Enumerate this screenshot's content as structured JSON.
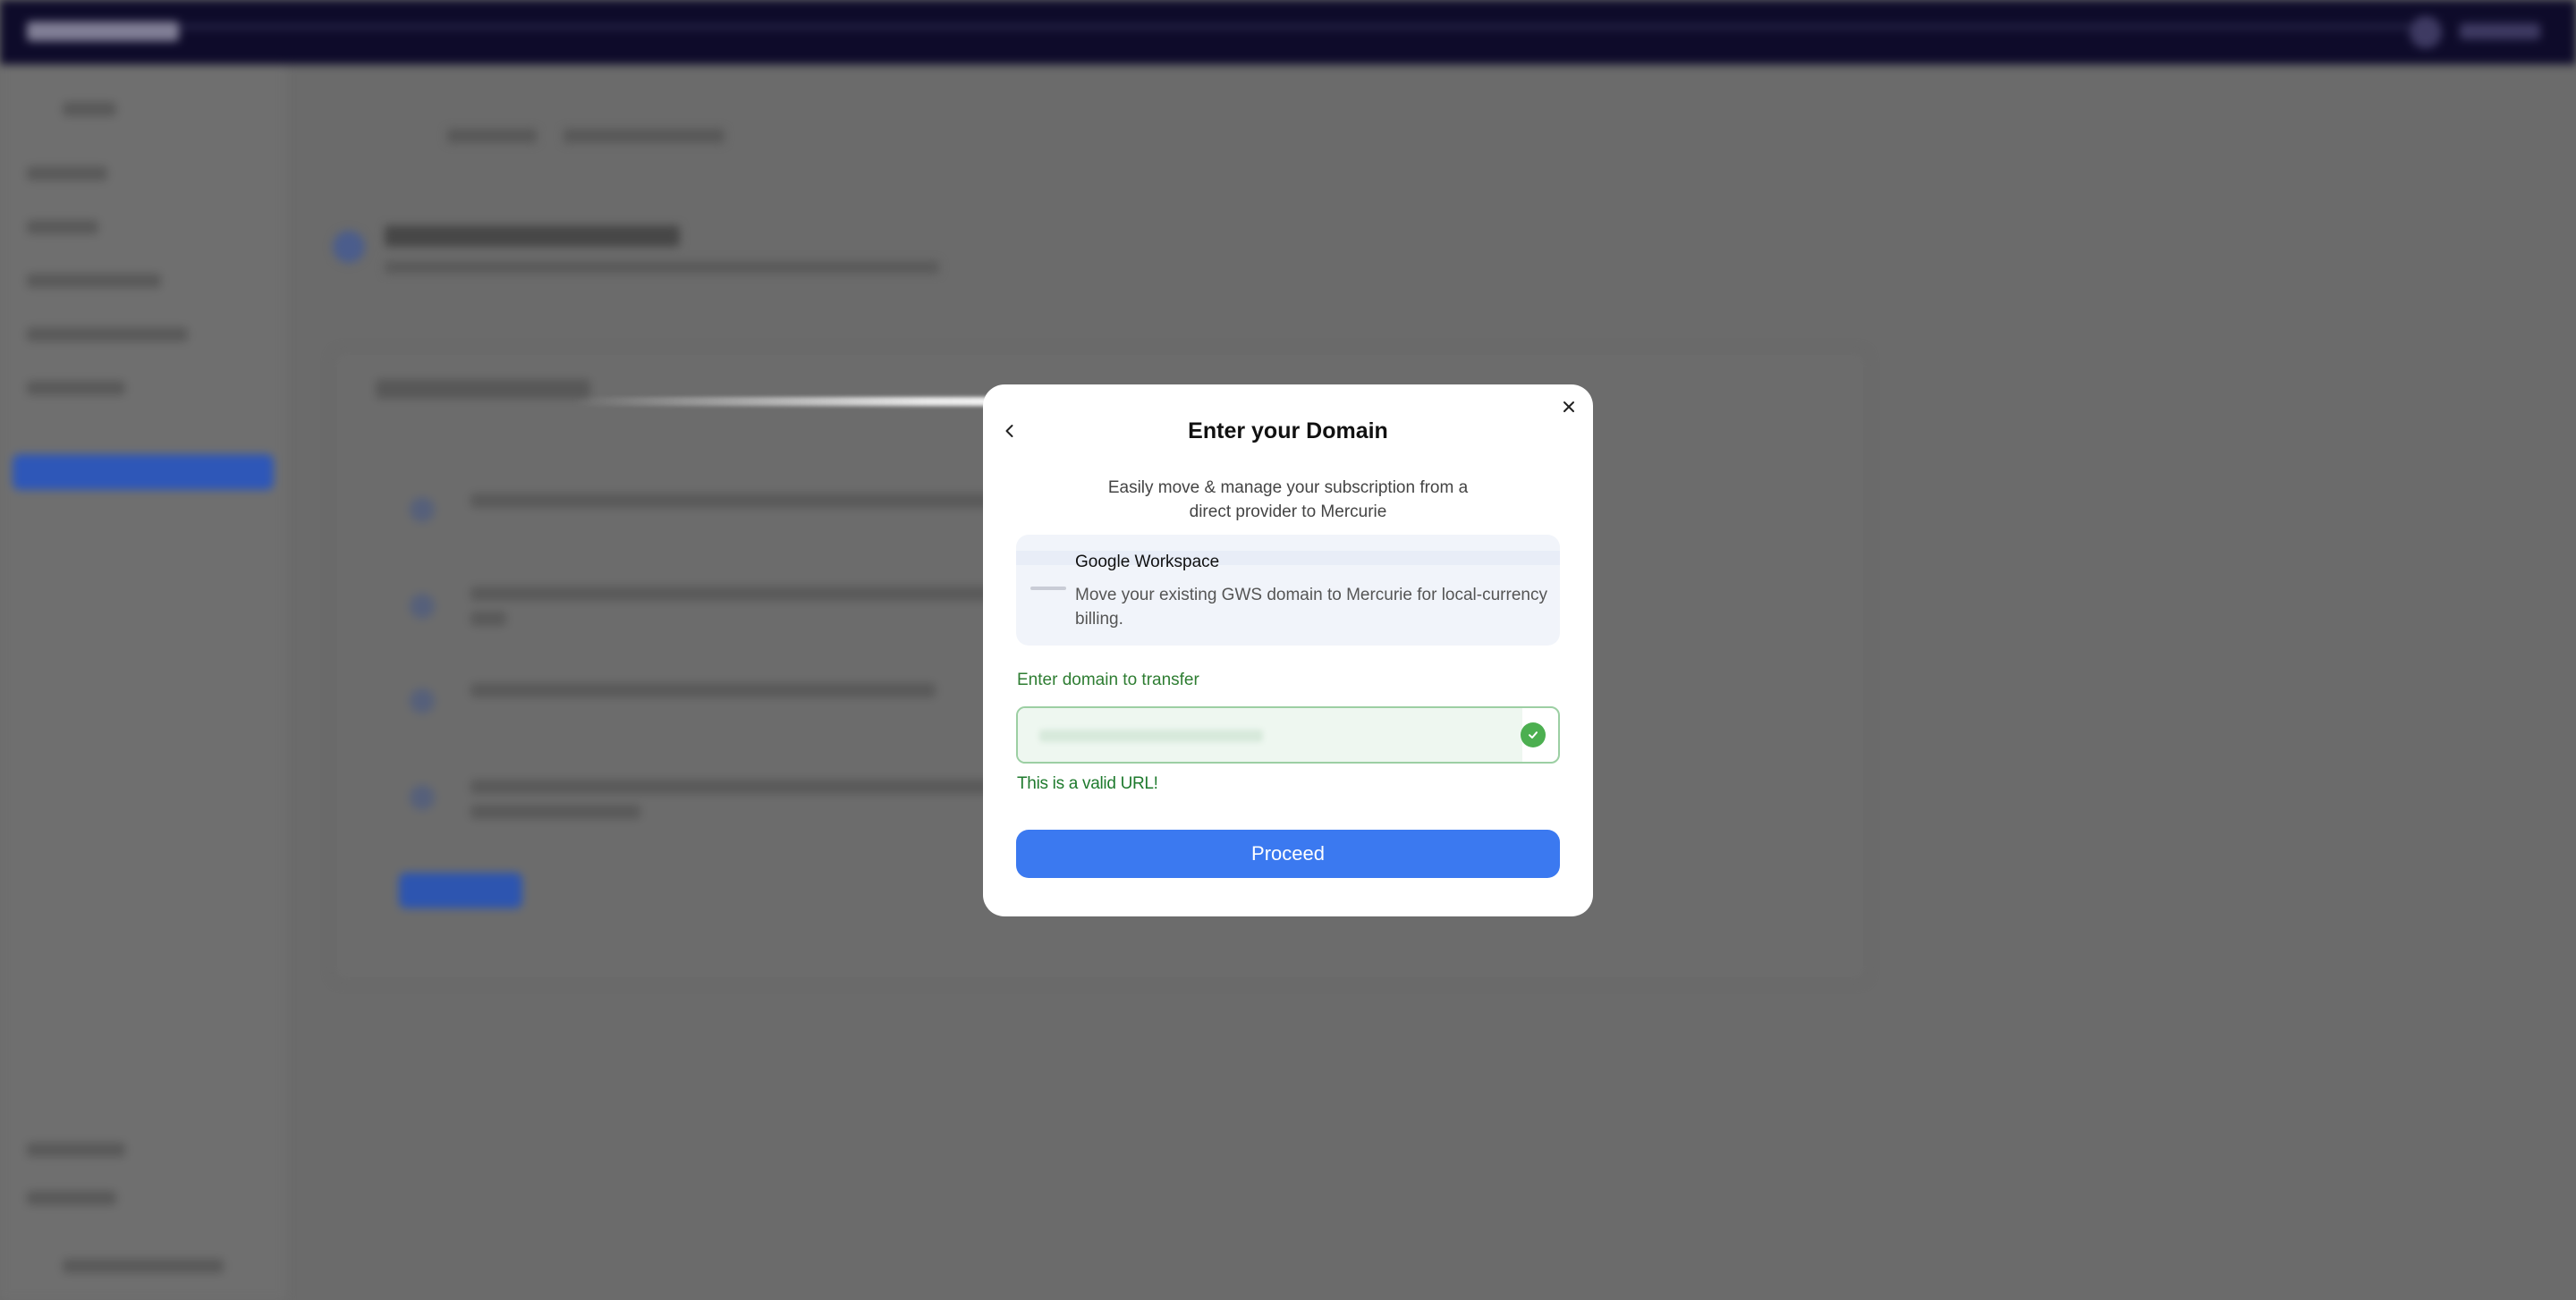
{
  "modal": {
    "title": "Enter your Domain",
    "description": "Easily move & manage your subscription from a direct provider to Mercurie",
    "provider": {
      "name": "Google Workspace",
      "description": "Move your existing GWS domain to Mercurie for local-currency billing."
    },
    "field_label": "Enter domain to transfer",
    "input_value": "",
    "validation_message": "This is a valid URL!",
    "proceed_label": "Proceed"
  },
  "colors": {
    "accent": "#3b79f0",
    "success": "#4caf50",
    "topbar": "#0e0b2a"
  },
  "icons": {
    "back": "chevron-left-icon",
    "close": "close-icon",
    "valid": "check-circle-icon"
  }
}
